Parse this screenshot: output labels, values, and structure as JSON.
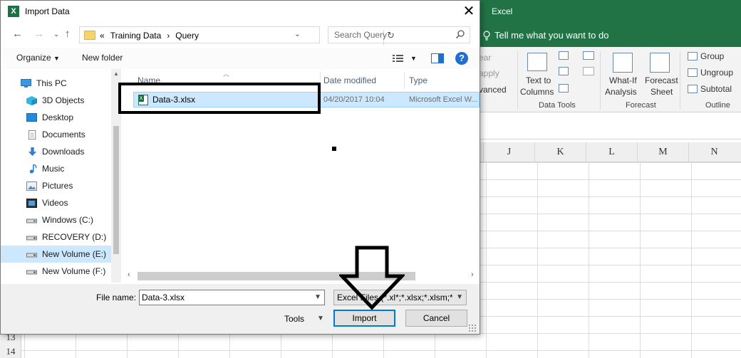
{
  "excel": {
    "app_title": "Excel",
    "tell_me": "Tell me what you want to do",
    "ribbon_partial": [
      "ear",
      "apply",
      "vanced"
    ],
    "ribbon_buttons": {
      "text_to_columns_l1": "Text to",
      "text_to_columns_l2": "Columns",
      "what_if_l1": "What-If",
      "what_if_l2": "Analysis",
      "forecast_sheet_l1": "Forecast",
      "forecast_sheet_l2": "Sheet",
      "group": "Group",
      "ungroup": "Ungroup",
      "subtotal": "Subtotal"
    },
    "group_labels": {
      "data_tools": "Data Tools",
      "forecast": "Forecast",
      "outline": "Outline"
    },
    "columns": [
      "J",
      "K",
      "L",
      "M",
      "N"
    ],
    "rows": [
      "13",
      "14"
    ]
  },
  "dialog": {
    "title": "Import Data",
    "breadcrumb": [
      "«",
      "Training Data",
      "›",
      "Query"
    ],
    "search_placeholder": "Search Query",
    "toolbar": {
      "organize": "Organize",
      "new_folder": "New folder"
    },
    "nav_items": [
      {
        "label": "This PC",
        "icon": "pc-icon"
      },
      {
        "label": "3D Objects",
        "icon": "cube-icon"
      },
      {
        "label": "Desktop",
        "icon": "desktop-icon"
      },
      {
        "label": "Documents",
        "icon": "document-icon"
      },
      {
        "label": "Downloads",
        "icon": "download-icon"
      },
      {
        "label": "Music",
        "icon": "music-icon"
      },
      {
        "label": "Pictures",
        "icon": "picture-icon"
      },
      {
        "label": "Videos",
        "icon": "video-icon"
      },
      {
        "label": "Windows (C:)",
        "icon": "drive-icon"
      },
      {
        "label": "RECOVERY (D:)",
        "icon": "drive-icon"
      },
      {
        "label": "New Volume (E:)",
        "icon": "drive-icon",
        "selected": true
      },
      {
        "label": "New Volume (F:)",
        "icon": "drive-icon"
      }
    ],
    "columns": {
      "name": "Name",
      "date": "Date modified",
      "type": "Type"
    },
    "files": [
      {
        "name": "Data-3.xlsx",
        "date": "04/20/2017 10:04",
        "type": "Microsoft Excel W..."
      }
    ],
    "file_name_label": "File name:",
    "file_name_value": "Data-3.xlsx",
    "file_type": "Excel Files (*.xl*;*.xlsx;*.xlsm;*.xl",
    "tools": "Tools",
    "import_btn": "Import",
    "cancel_btn": "Cancel"
  },
  "colors": {
    "excel_green": "#217346",
    "selection_blue": "#cce8ff",
    "accent_blue": "#0078d7"
  }
}
